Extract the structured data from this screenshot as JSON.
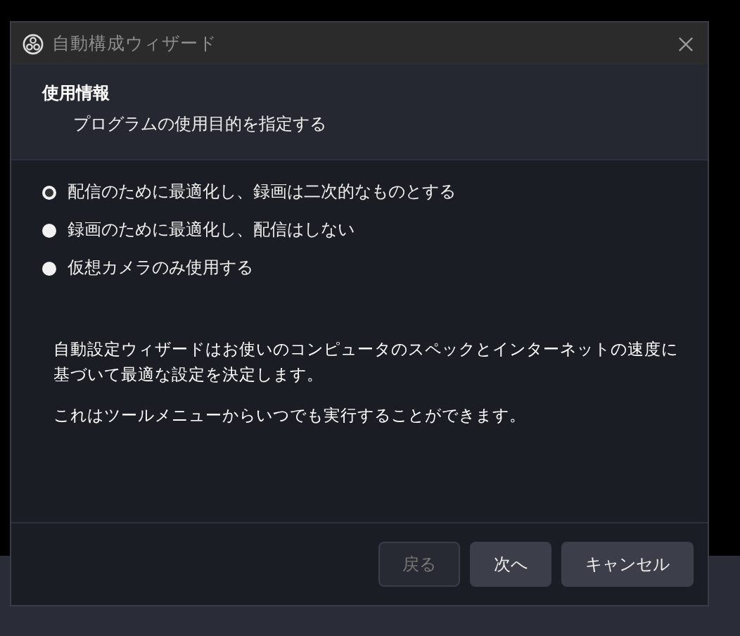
{
  "window": {
    "title": "自動構成ウィザード"
  },
  "header": {
    "title": "使用情報",
    "subtitle": "プログラムの使用目的を指定する"
  },
  "options": [
    {
      "label": "配信のために最適化し、録画は二次的なものとする",
      "selected": true
    },
    {
      "label": "録画のために最適化し、配信はしない",
      "selected": false
    },
    {
      "label": "仮想カメラのみ使用する",
      "selected": false
    }
  ],
  "paragraphs": [
    "自動設定ウィザードはお使いのコンピュータのスペックとインターネットの速度に基づいて最適な設定を決定します。",
    "これはツールメニューからいつでも実行することができます。"
  ],
  "buttons": [
    {
      "label": "戻る",
      "disabled": true
    },
    {
      "label": "次へ",
      "disabled": false
    },
    {
      "label": "キャンセル",
      "disabled": false
    }
  ]
}
